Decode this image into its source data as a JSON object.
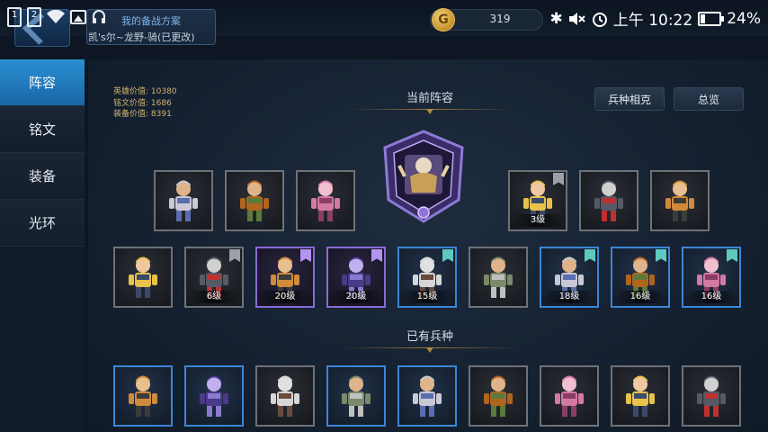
{
  "status_bar": {
    "sim1": "1",
    "sim2": "2",
    "time": "上午 10:22",
    "battery_pct": "24%",
    "battery_level": 0.24,
    "icons": [
      "sim1-icon",
      "sim2-icon",
      "wifi-icon",
      "image-icon",
      "headset-icon",
      "bluetooth-icon",
      "mute-icon",
      "alarm-icon",
      "battery-icon"
    ]
  },
  "plan": {
    "title": "我的备战方案",
    "subtitle": "凯's尔~龙野-骑(已更改)"
  },
  "currency": {
    "coins": "319",
    "coin_glyph": "G"
  },
  "sidebar": {
    "items": [
      {
        "label": "阵容",
        "active": true
      },
      {
        "label": "铭文",
        "active": false
      },
      {
        "label": "装备",
        "active": false
      },
      {
        "label": "光环",
        "active": false
      }
    ]
  },
  "stats": {
    "hero": "英雄价值: 10380",
    "inscription": "铭文价值: 1686",
    "equipment": "装备价值: 8391"
  },
  "sections": {
    "current_lineup": "当前阵容",
    "owned_units": "已有兵种"
  },
  "buttons": {
    "counter": "兵种相克",
    "overview": "总览"
  },
  "lineup_row1": [
    {
      "name": "knight",
      "level": "",
      "frame": "gray",
      "flag": ""
    },
    {
      "name": "swordsman",
      "level": "",
      "frame": "gray",
      "flag": ""
    },
    {
      "name": "pink-mummy",
      "level": "",
      "frame": "gray",
      "flag": ""
    },
    {
      "name": "blonde-warrior",
      "level": "3级",
      "frame": "gray",
      "flag": "gray"
    },
    {
      "name": "ninja",
      "level": "",
      "frame": "gray",
      "flag": ""
    },
    {
      "name": "beast-warrior",
      "level": "",
      "frame": "gray",
      "flag": ""
    }
  ],
  "lineup_row2": [
    {
      "name": "crossbowman",
      "level": "",
      "frame": "gray",
      "flag": ""
    },
    {
      "name": "skeleton",
      "level": "6级",
      "frame": "gray",
      "flag": "gray"
    },
    {
      "name": "shield-knight",
      "level": "20级",
      "frame": "purple",
      "flag": "purple"
    },
    {
      "name": "blue-hair-brawler",
      "level": "20级",
      "frame": "purple",
      "flag": "purple"
    },
    {
      "name": "horse-rider-red",
      "level": "15级",
      "frame": "blue",
      "flag": "teal"
    },
    {
      "name": "horse-rider-gold",
      "level": "",
      "frame": "gray",
      "flag": ""
    },
    {
      "name": "werewolf",
      "level": "18级",
      "frame": "blue",
      "flag": "teal"
    },
    {
      "name": "dragon-rider",
      "level": "16级",
      "frame": "blue",
      "flag": "teal"
    },
    {
      "name": "lancer",
      "level": "16级",
      "frame": "blue",
      "flag": "teal"
    }
  ],
  "owned_row": [
    {
      "name": "crystal-golem",
      "frame": "blue"
    },
    {
      "name": "elf-archer",
      "frame": "blue"
    },
    {
      "name": "dual-sword",
      "frame": "gray"
    },
    {
      "name": "silver-knight",
      "frame": "blue"
    },
    {
      "name": "blue-sorceress",
      "frame": "blue"
    },
    {
      "name": "red-knight",
      "frame": "gray"
    },
    {
      "name": "white-priest",
      "frame": "gray"
    },
    {
      "name": "dark-soldier",
      "frame": "gray"
    },
    {
      "name": "bare-fighter",
      "frame": "gray"
    }
  ]
}
